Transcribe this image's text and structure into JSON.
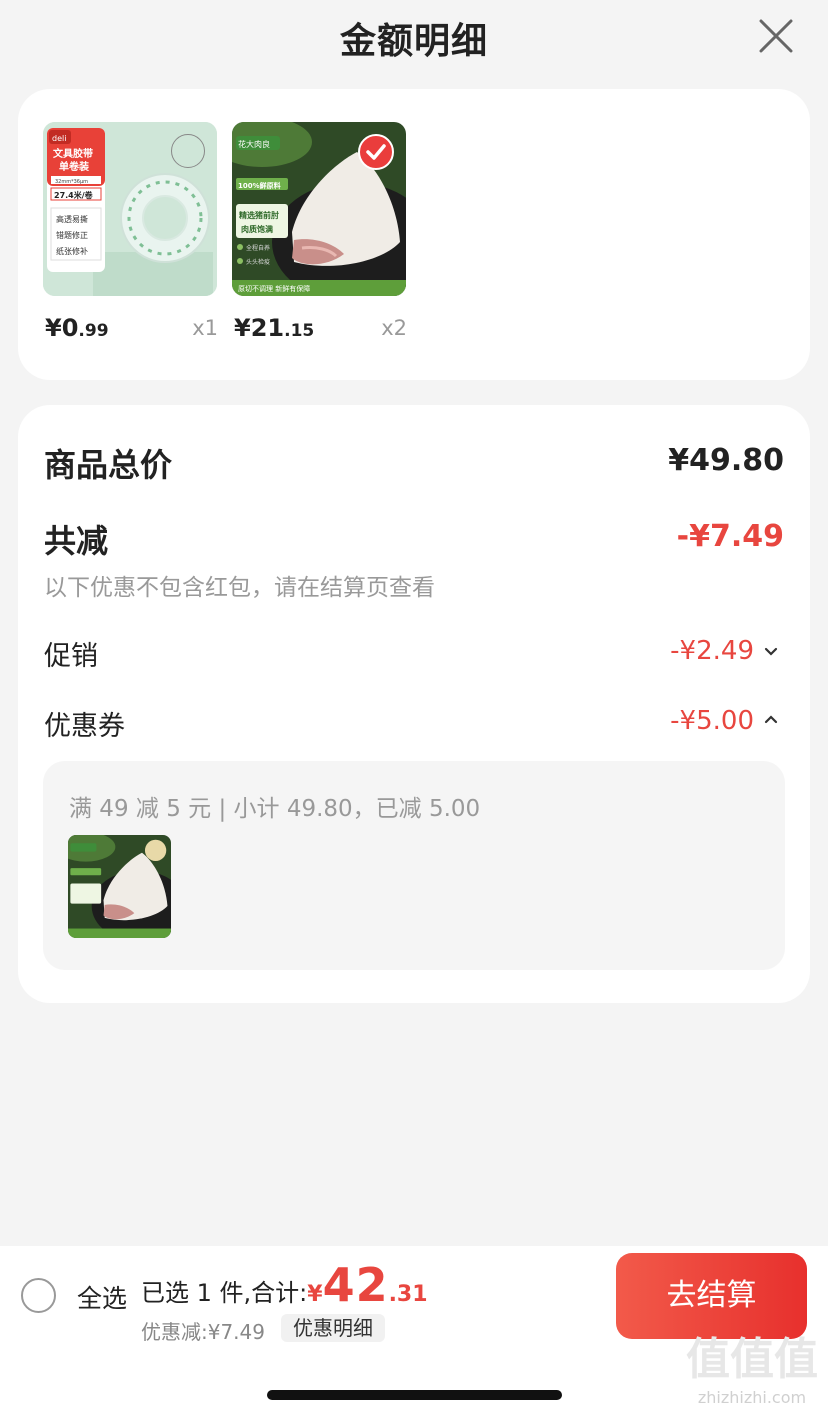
{
  "header": {
    "title": "金额明细"
  },
  "products": [
    {
      "price_int": "¥0",
      "price_dec": ".99",
      "qty": "x1",
      "selected": false,
      "pkg": {
        "brand": "deli",
        "t1": "文具胶带",
        "t2": "单卷装",
        "spec": "32mm*36μm",
        "len": "27.4米/卷",
        "f1": "高透易撕",
        "f2": "错题修正",
        "f3": "纸张修补"
      }
    },
    {
      "price_int": "¥21",
      "price_dec": ".15",
      "qty": "x2",
      "selected": true,
      "pkg": {
        "brand": "花大肉良",
        "tag": "100%鲜原料",
        "t1": "精选猪前肘",
        "t2": "肉质饱满",
        "b1": "全程自养",
        "b2": "头头检疫",
        "foot": "原切不调理  新鲜有保障"
      }
    }
  ],
  "summary": {
    "total_label": "商品总价",
    "total_value": "¥49.80",
    "reduce_label": "共减",
    "reduce_value": "-¥7.49",
    "hint": "以下优惠不包含红包，请在结算页查看",
    "promo_label": "促销",
    "promo_value": "-¥2.49",
    "coupon_label": "优惠券",
    "coupon_value": "-¥5.00",
    "coupon_desc": "满 49 减 5 元 | 小计 49.80，已减 5.00"
  },
  "bottom": {
    "select_all": "全选",
    "selected_text": "已选 1 件,合计:",
    "currency": "¥",
    "total_int": "42",
    "total_dec": ".31",
    "discount": "优惠减:¥7.49",
    "detail": "优惠明细",
    "checkout": "去结算"
  },
  "watermark": {
    "logo": "值值值",
    "url": "zhizhizhi.com"
  },
  "colors": {
    "accent_red": "#e8463f",
    "checkout_gradient_start": "#f25a4a",
    "checkout_gradient_end": "#e7302d"
  }
}
